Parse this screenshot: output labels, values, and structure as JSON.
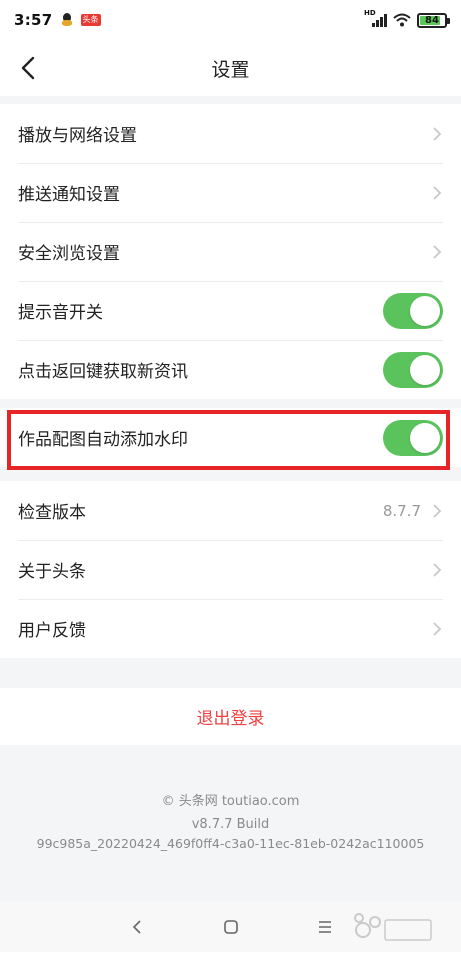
{
  "status_bar": {
    "time": "3:57",
    "app_badge": "头条",
    "battery": "84",
    "battery_level": 0.84,
    "network": "HD"
  },
  "header": {
    "title": "设置"
  },
  "settings": {
    "group1": [
      {
        "label": "播放与网络设置",
        "control": "chevron"
      },
      {
        "label": "推送通知设置",
        "control": "chevron"
      },
      {
        "label": "安全浏览设置",
        "control": "chevron"
      },
      {
        "label": "提示音开关",
        "control": "toggle",
        "on": true
      },
      {
        "label": "点击返回键获取新资讯",
        "control": "toggle",
        "on": true
      }
    ],
    "group2": [
      {
        "label": "作品配图自动添加水印",
        "control": "toggle",
        "on": true
      }
    ],
    "group3": [
      {
        "label": "检查版本",
        "value": "8.7.7",
        "control": "chevron"
      },
      {
        "label": "关于头条",
        "control": "chevron"
      },
      {
        "label": "用户反馈",
        "control": "chevron"
      }
    ]
  },
  "logout": {
    "label": "退出登录"
  },
  "footer": {
    "copyright": "© 头条网 toutiao.com",
    "version": "v8.7.7 Build",
    "build": "99c985a_20220424_469f0ff4-c3a0-11ec-81eb-0242ac110005"
  },
  "colors": {
    "accent_green": "#5ac35c",
    "logout_red": "#f04142",
    "highlight_red": "#e52526"
  },
  "icons": [
    "back-icon",
    "chevron-right-icon",
    "nav-back-icon",
    "nav-home-icon",
    "nav-menu-icon"
  ]
}
